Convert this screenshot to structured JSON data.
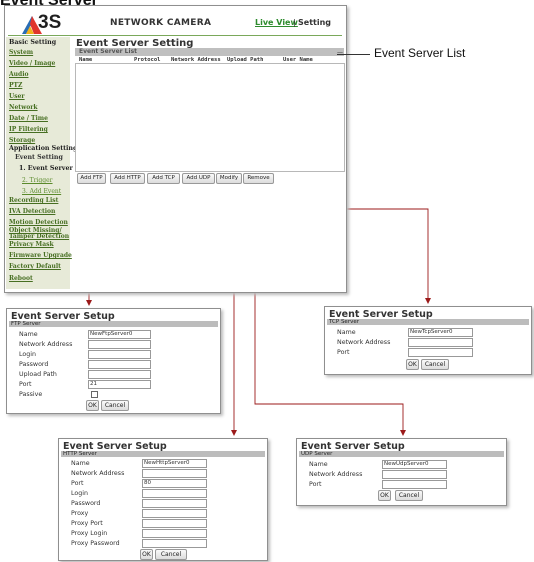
{
  "heading": "Event Server",
  "camera": {
    "logo_text": "3S",
    "title": "NETWORK CAMERA",
    "live_view": "Live View",
    "separator": "|",
    "setting": "Setting",
    "page_title": "Event Server Setting",
    "list_label": "Event Server List",
    "collapse_glyph": "—",
    "columns": [
      "Name",
      "Protocol",
      "Network Address",
      "Upload Path",
      "User Name"
    ],
    "buttons": [
      "Add FTP",
      "Add HTTP",
      "Add TCP",
      "Add UDP",
      "Modify",
      "Remove"
    ]
  },
  "sidebar": {
    "basic_setting": "Basic Setting",
    "basic_items": [
      "System",
      "Video / Image",
      "Audio",
      "PTZ",
      "User",
      "Network",
      "Date / Time",
      "IP Filtering",
      "Storage"
    ],
    "application_setting": "Application Setting",
    "event_setting": "Event Setting",
    "event_server": "1. Event Server",
    "trigger": "2. Trigger",
    "add_event": "3. Add Event",
    "app_items": [
      "Recording List",
      "IVA Detection",
      "Motion Detection",
      "Object Missing/ Tamper Detection",
      "Privacy Mask",
      "Firmware Upgrade",
      "Factory Default",
      "Reboot"
    ]
  },
  "callout": "Event Server List",
  "dialogs": {
    "ftp": {
      "title": "Event Server Setup",
      "section": "FTP Server",
      "fields": [
        {
          "label": "Name",
          "value": "NewFtpServer0"
        },
        {
          "label": "Network Address",
          "value": ""
        },
        {
          "label": "Login",
          "value": ""
        },
        {
          "label": "Password",
          "value": ""
        },
        {
          "label": "Upload Path",
          "value": ""
        },
        {
          "label": "Port",
          "value": "21"
        }
      ],
      "checkbox_label": "Passive",
      "ok": "OK",
      "cancel": "Cancel"
    },
    "tcp": {
      "title": "Event Server Setup",
      "section": "TCP Server",
      "fields": [
        {
          "label": "Name",
          "value": "NewTcpServer0"
        },
        {
          "label": "Network Address",
          "value": ""
        },
        {
          "label": "Port",
          "value": ""
        }
      ],
      "ok": "OK",
      "cancel": "Cancel"
    },
    "http": {
      "title": "Event Server Setup",
      "section": "HTTP Server",
      "fields": [
        {
          "label": "Name",
          "value": "NewHttpServer0"
        },
        {
          "label": "Network Address",
          "value": ""
        },
        {
          "label": "Port",
          "value": "80"
        },
        {
          "label": "Login",
          "value": ""
        },
        {
          "label": "Password",
          "value": ""
        },
        {
          "label": "Proxy",
          "value": ""
        },
        {
          "label": "Proxy Port",
          "value": ""
        },
        {
          "label": "Proxy Login",
          "value": ""
        },
        {
          "label": "Proxy Password",
          "value": ""
        }
      ],
      "ok": "OK",
      "cancel": "Cancel"
    },
    "udp": {
      "title": "Event Server Setup",
      "section": "UDP Server",
      "fields": [
        {
          "label": "Name",
          "value": "NewUdpServer0"
        },
        {
          "label": "Network Address",
          "value": ""
        },
        {
          "label": "Port",
          "value": ""
        }
      ],
      "ok": "OK",
      "cancel": "Cancel"
    }
  },
  "colors": {
    "arrow": "#9b1a1a",
    "sidebar_bg": "#e7ead8",
    "link_green": "#466e21",
    "bar_gray": "#bcbcbc"
  }
}
